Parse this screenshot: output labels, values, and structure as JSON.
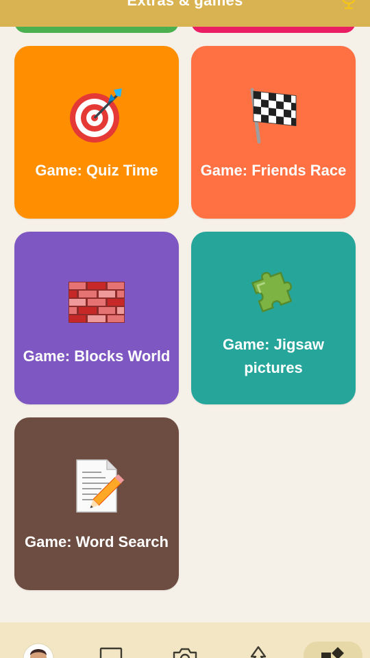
{
  "header": {
    "title": "Extras & games",
    "trophy_icon": "trophy-icon",
    "background": "#D9B352"
  },
  "cards": [
    {
      "label": "Game: Quiz Time",
      "icon": "dart-target-icon",
      "color": "#FF8F00"
    },
    {
      "label": "Game: Friends Race",
      "icon": "checkered-flag-icon",
      "color": "#FF7043"
    },
    {
      "label": "Game: Blocks World",
      "icon": "brick-icon",
      "color": "#7E57C2"
    },
    {
      "label": "Game: Jigsaw pictures",
      "icon": "puzzle-piece-icon",
      "color": "#26A69A"
    },
    {
      "label": "Game: Word Search",
      "icon": "memo-pencil-icon",
      "color": "#6D4C41"
    }
  ],
  "bottom_nav": {
    "items": [
      {
        "icon": "avatar-icon"
      },
      {
        "icon": "book-icon"
      },
      {
        "icon": "camera-icon"
      },
      {
        "icon": "tree-icon"
      },
      {
        "icon": "extras-icon",
        "active": true
      }
    ]
  }
}
